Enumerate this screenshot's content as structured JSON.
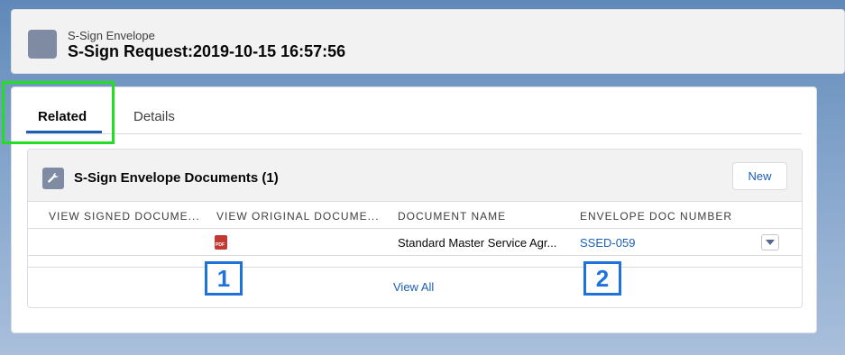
{
  "header": {
    "eyebrow": "S-Sign Envelope",
    "title": "S-Sign Request:2019-10-15 16:57:56"
  },
  "tabs": [
    {
      "label": "Related",
      "active": true
    },
    {
      "label": "Details",
      "active": false
    }
  ],
  "related_list": {
    "title": "S-Sign Envelope Documents (1)",
    "new_button": "New",
    "columns": [
      "VIEW SIGNED DOCUME...",
      "VIEW ORIGINAL DOCUME...",
      "DOCUMENT NAME",
      "ENVELOPE DOC NUMBER"
    ],
    "rows": [
      {
        "view_signed": "",
        "view_original_icon": "pdf-icon",
        "document_name": "Standard Master Service Agr...",
        "envelope_doc_number": "SSED-059"
      }
    ],
    "view_all": "View All"
  },
  "markers": [
    "1",
    "2"
  ],
  "colors": {
    "accent": "#1b5fb4",
    "highlight": "#22dd22",
    "marker": "#1f72d9"
  }
}
